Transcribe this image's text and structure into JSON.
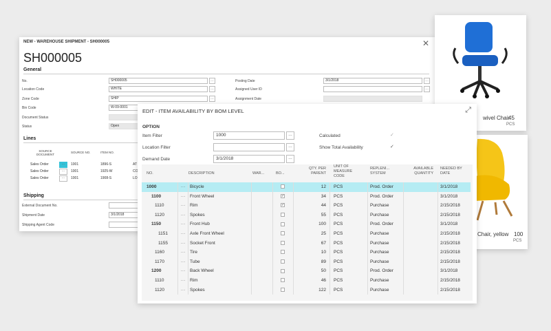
{
  "back": {
    "window_title": "NEW - WAREHOUSE SHIPMENT - SH000005",
    "big_title": "SH000005",
    "general_label": "General",
    "fields_left": [
      {
        "label": "No.",
        "value": "SH000005"
      },
      {
        "label": "Location Code",
        "value": "WHITE"
      },
      {
        "label": "Zone Code",
        "value": "SHIP"
      },
      {
        "label": "Bin Code",
        "value": "W-09-0001"
      },
      {
        "label": "Document Status",
        "value": ""
      },
      {
        "label": "Status",
        "value": "Open"
      }
    ],
    "fields_right": [
      {
        "label": "Posting Date",
        "value": "3/1/2018"
      },
      {
        "label": "Assigned User ID",
        "value": ""
      },
      {
        "label": "Assignment Date",
        "value": ""
      }
    ],
    "lines_label": "Lines",
    "lines_headers": [
      "SOURCE DOCUMENT",
      "SOURCE NO.",
      "ITEM NO."
    ],
    "lines_rows": [
      {
        "doc": "Sales Order",
        "no": "1001",
        "item": "1896-S",
        "extra": "AT"
      },
      {
        "doc": "Sales Order",
        "no": "1001",
        "item": "1925-W",
        "extra": "CO"
      },
      {
        "doc": "Sales Order",
        "no": "1001",
        "item": "1908-S",
        "extra": "LO"
      }
    ],
    "shipping_label": "Shipping",
    "shipping_fields": [
      {
        "label": "External Document No.",
        "value": ""
      },
      {
        "label": "Shipment Date",
        "value": "3/1/2018"
      },
      {
        "label": "Shipping Agent Code",
        "value": ""
      }
    ]
  },
  "products": [
    {
      "name": "wivel Chair",
      "qty": "45",
      "unit": "PCS",
      "color": "#1f6fd6"
    },
    {
      "name": "Chair, yellow",
      "qty": "100",
      "unit": "PCS",
      "color": "#f5c518"
    }
  ],
  "dialog": {
    "title": "EDIT - ITEM AVAILABILITY BY BOM LEVEL",
    "option_label": "OPTION",
    "item_filter_label": "Item Filter",
    "item_filter_value": "1000",
    "location_filter_label": "Location Filter",
    "location_filter_value": "",
    "demand_date_label": "Demand Date",
    "demand_date_value": "3/1/2018",
    "calculated_label": "Calculated",
    "show_total_label": "Show Total Availability",
    "columns": [
      "NO.",
      "DESCRIPTION",
      "WAR...",
      "BO...",
      "QTY. PER PARENT",
      "UNIT OF MEASURE CODE",
      "REPLENI... SYSTEM",
      "AVAILABLE QUANTITY",
      "NEEDED BY DATE"
    ],
    "rows": [
      {
        "no": "1000",
        "desc": "Bicycle",
        "bo": false,
        "qty": "12",
        "uom": "PCS",
        "rep": "Prod. Order",
        "date": "3/1/2018",
        "level": 0,
        "bold": true,
        "sel": true
      },
      {
        "no": "1100",
        "desc": "Front Wheel",
        "bo": true,
        "qty": "34",
        "uom": "PCS",
        "rep": "Prod. Order",
        "date": "3/1/2018",
        "level": 1,
        "bold": true,
        "sel": false
      },
      {
        "no": "1110",
        "desc": "Rim",
        "bo": true,
        "qty": "44",
        "uom": "PCS",
        "rep": "Purchase",
        "date": "2/15/2018",
        "level": 2,
        "bold": false,
        "sel": false
      },
      {
        "no": "1120",
        "desc": "Spokes",
        "bo": false,
        "qty": "55",
        "uom": "PCS",
        "rep": "Purchase",
        "date": "2/15/2018",
        "level": 2,
        "bold": false,
        "sel": false
      },
      {
        "no": "1150",
        "desc": "Front Hub",
        "bo": false,
        "qty": "100",
        "uom": "PCS",
        "rep": "Prod. Order",
        "date": "3/1/2018",
        "level": 1,
        "bold": true,
        "sel": false
      },
      {
        "no": "1151",
        "desc": "Axle Front Wheel",
        "bo": false,
        "qty": "25",
        "uom": "PCS",
        "rep": "Purchase",
        "date": "2/15/2018",
        "level": 3,
        "bold": false,
        "sel": false
      },
      {
        "no": "1155",
        "desc": "Socket Front",
        "bo": false,
        "qty": "67",
        "uom": "PCS",
        "rep": "Purchase",
        "date": "2/15/2018",
        "level": 4,
        "bold": false,
        "sel": false
      },
      {
        "no": "1160",
        "desc": "Tire",
        "bo": false,
        "qty": "10",
        "uom": "PCS",
        "rep": "Purchase",
        "date": "2/15/2018",
        "level": 2,
        "bold": false,
        "sel": false
      },
      {
        "no": "1170",
        "desc": "Tube",
        "bo": false,
        "qty": "89",
        "uom": "PCS",
        "rep": "Purchase",
        "date": "2/15/2018",
        "level": 2,
        "bold": false,
        "sel": false
      },
      {
        "no": "1200",
        "desc": "Back Wheel",
        "bo": false,
        "qty": "50",
        "uom": "PCS",
        "rep": "Prod. Order",
        "date": "3/1/2018",
        "level": 1,
        "bold": true,
        "sel": false
      },
      {
        "no": "1110",
        "desc": "Rim",
        "bo": false,
        "qty": "46",
        "uom": "PCS",
        "rep": "Purchase",
        "date": "2/15/2018",
        "level": 2,
        "bold": false,
        "sel": false
      },
      {
        "no": "1120",
        "desc": "Spokes",
        "bo": false,
        "qty": "122",
        "uom": "PCS",
        "rep": "Purchase",
        "date": "2/15/2018",
        "level": 2,
        "bold": false,
        "sel": false
      }
    ]
  }
}
